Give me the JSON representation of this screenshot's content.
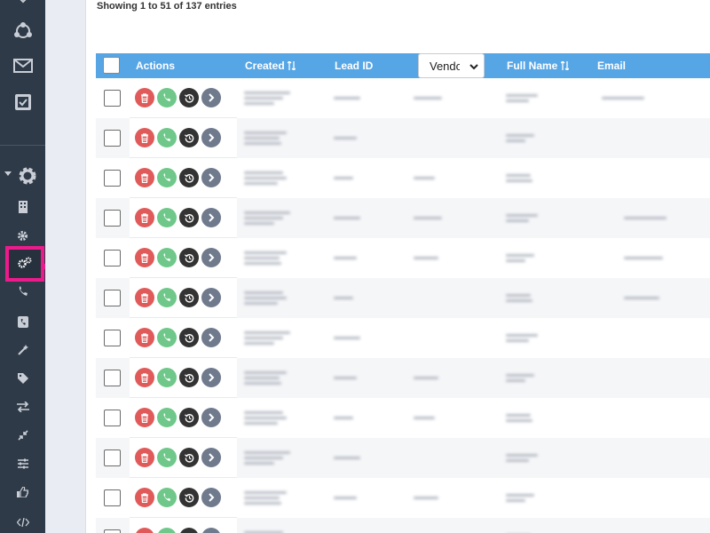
{
  "table_info": {
    "entries_text": "Showing 1 to 51 of 137 entries"
  },
  "table": {
    "columns": [
      "Actions",
      "Created",
      "Lead ID",
      "Full Name",
      "Email"
    ],
    "vendor_filter": {
      "selected": "Vendor"
    },
    "row_count_visible": 12
  },
  "sidebar": {
    "icons": [
      "share-network-icon",
      "mail-icon",
      "clipboard-check-icon",
      "gear-icon",
      "building-icon",
      "small-gear-icon",
      "gears-icon",
      "phone-icon",
      "phone-book-icon",
      "magic-wand-icon",
      "tag-icon",
      "swap-arrows-icon",
      "compress-icon",
      "sliders-icon",
      "thumbs-up-icon",
      "code-icon"
    ],
    "highlighted": "gears-icon"
  },
  "overlay": {
    "badge_icon": "mouse-icon",
    "accent_color": "#ec1b8c"
  },
  "colors": {
    "header": "#56a6e6",
    "sidebar": "#2f3a48",
    "delete": "#e05a5a",
    "call": "#6fc88a",
    "history": "#333333",
    "next": "#6f7a8d"
  }
}
